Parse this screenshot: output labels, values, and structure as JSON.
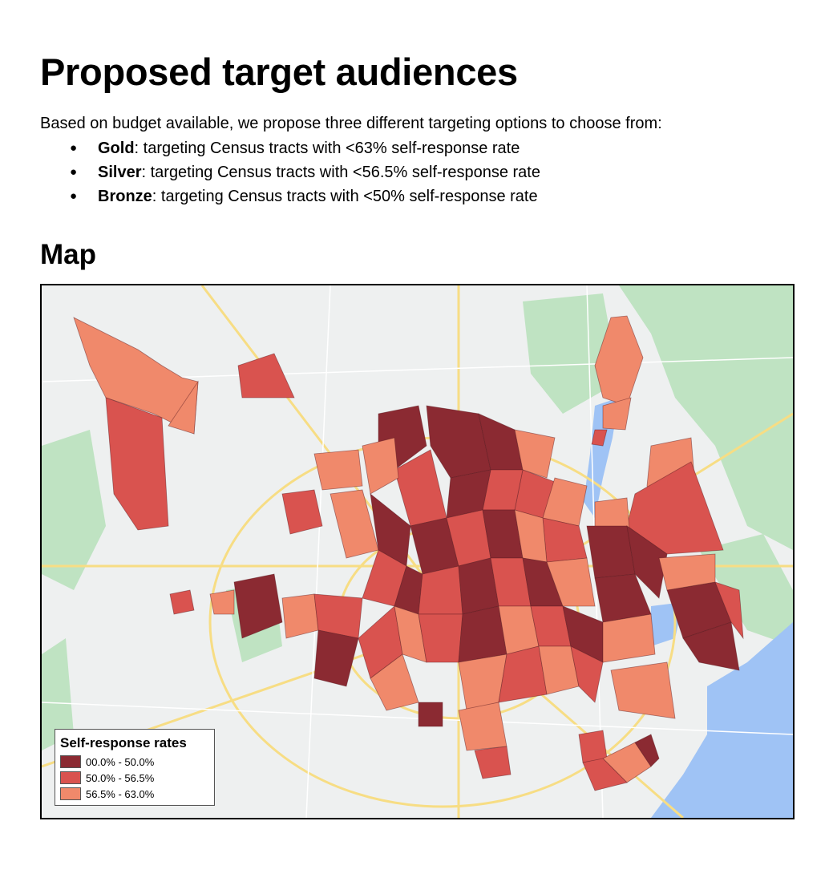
{
  "page": {
    "title": "Proposed target audiences",
    "intro": "Based on budget available, we propose three different targeting options to choose from:",
    "options": [
      {
        "name": "Gold",
        "description": ": targeting Census tracts with <63% self-response rate"
      },
      {
        "name": "Silver",
        "description": ": targeting Census tracts with <56.5% self-response rate"
      },
      {
        "name": "Bronze",
        "description": ": targeting Census tracts with <50% self-response rate"
      }
    ],
    "bullet": "●",
    "map_heading": "Map"
  },
  "map": {
    "legend": {
      "title": "Self-response rates",
      "items": [
        {
          "label": "00.0% - 50.0%",
          "color": "#8b2a32"
        },
        {
          "label": "50.0% - 56.5%",
          "color": "#d9534f"
        },
        {
          "label": "56.5% - 63.0%",
          "color": "#f0896b"
        }
      ]
    },
    "colors": {
      "water": "#9fc3f5",
      "park": "#bfe3c2",
      "land": "#eef0f0",
      "road": "#f7dd84"
    }
  }
}
